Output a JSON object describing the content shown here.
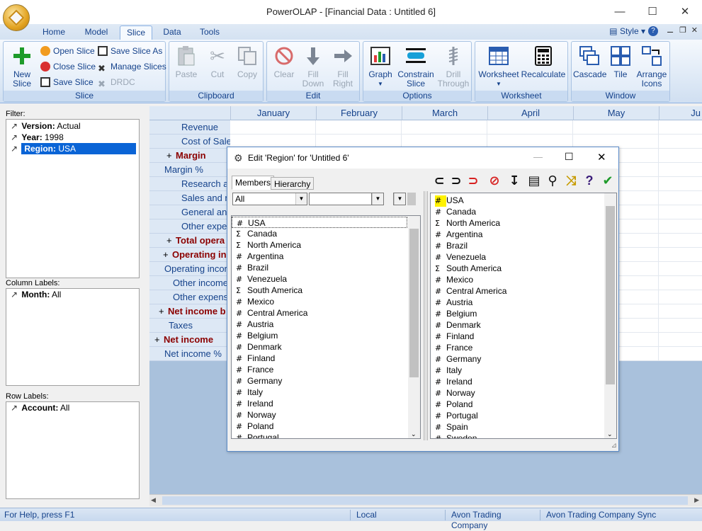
{
  "window": {
    "title": "PowerOLAP - [Financial Data : Untitled 6]"
  },
  "ribbon_tabs": [
    "Home",
    "Model",
    "Slice",
    "Data",
    "Tools"
  ],
  "style_menu": "Style",
  "ribbon": {
    "slice": {
      "label": "Slice",
      "new_slice": "New Slice",
      "open_slice": "Open Slice",
      "close_slice": "Close Slice",
      "save_slice": "Save Slice",
      "save_slice_as": "Save Slice As",
      "manage_slices": "Manage Slices",
      "drdc": "DRDC"
    },
    "clipboard": {
      "label": "Clipboard",
      "paste": "Paste",
      "cut": "Cut",
      "copy": "Copy"
    },
    "edit": {
      "label": "Edit",
      "clear": "Clear",
      "fill_down": "Fill Down",
      "fill_right": "Fill Right"
    },
    "options": {
      "label": "Options",
      "graph": "Graph",
      "constrain_slice": "Constrain Slice",
      "drill_through": "Drill Through"
    },
    "worksheet": {
      "label": "Worksheet",
      "worksheet": "Worksheet",
      "recalculate": "Recalculate"
    },
    "window": {
      "label": "Window",
      "cascade": "Cascade",
      "tile": "Tile",
      "arrange_icons": "Arrange Icons"
    }
  },
  "filter": {
    "label": "Filter:",
    "items": [
      {
        "name": "Version:",
        "value": "Actual"
      },
      {
        "name": "Year:",
        "value": "1998"
      },
      {
        "name": "Region:",
        "value": "USA"
      }
    ]
  },
  "column_labels": {
    "label": "Column Labels:",
    "items": [
      {
        "name": "Month:",
        "value": "All"
      }
    ]
  },
  "row_labels": {
    "label": "Row Labels:",
    "items": [
      {
        "name": "Account:",
        "value": "All"
      }
    ]
  },
  "grid": {
    "columns": [
      "January",
      "February",
      "March",
      "April",
      "May",
      "Ju"
    ],
    "rows": [
      "Revenue",
      "Cost of Sale",
      "Margin",
      "Margin %",
      "Research a",
      "Sales and m",
      "General an",
      "Other expe",
      "Total opera",
      "Operating in",
      "Operating incor",
      "Other income",
      "Other expens",
      "Net income b",
      "Taxes",
      "Net income",
      "Net income %"
    ]
  },
  "dialog": {
    "title": "Edit 'Region' for 'Untitled 6'",
    "tabs": [
      "Members",
      "Hierarchy"
    ],
    "filter_combo": "All",
    "left_members": [
      {
        "g": "#",
        "n": "USA"
      },
      {
        "g": "Σ",
        "n": "Canada"
      },
      {
        "g": "Σ",
        "n": "North America"
      },
      {
        "g": "#",
        "n": "Argentina"
      },
      {
        "g": "#",
        "n": "Brazil"
      },
      {
        "g": "#",
        "n": "Venezuela"
      },
      {
        "g": "Σ",
        "n": "South America"
      },
      {
        "g": "#",
        "n": "Mexico"
      },
      {
        "g": "#",
        "n": "Central America"
      },
      {
        "g": "#",
        "n": "Austria"
      },
      {
        "g": "#",
        "n": "Belgium"
      },
      {
        "g": "#",
        "n": "Denmark"
      },
      {
        "g": "#",
        "n": "Finland"
      },
      {
        "g": "#",
        "n": "France"
      },
      {
        "g": "#",
        "n": "Germany"
      },
      {
        "g": "#",
        "n": "Italy"
      },
      {
        "g": "#",
        "n": "Ireland"
      },
      {
        "g": "#",
        "n": "Norway"
      },
      {
        "g": "#",
        "n": "Poland"
      },
      {
        "g": "#",
        "n": "Portugal"
      }
    ],
    "right_members": [
      {
        "g": "#",
        "n": "USA"
      },
      {
        "g": "#",
        "n": "Canada"
      },
      {
        "g": "Σ",
        "n": "North America"
      },
      {
        "g": "#",
        "n": "Argentina"
      },
      {
        "g": "#",
        "n": "Brazil"
      },
      {
        "g": "#",
        "n": "Venezuela"
      },
      {
        "g": "Σ",
        "n": "South America"
      },
      {
        "g": "#",
        "n": "Mexico"
      },
      {
        "g": "#",
        "n": "Central America"
      },
      {
        "g": "#",
        "n": "Austria"
      },
      {
        "g": "#",
        "n": "Belgium"
      },
      {
        "g": "#",
        "n": "Denmark"
      },
      {
        "g": "#",
        "n": "Finland"
      },
      {
        "g": "#",
        "n": "France"
      },
      {
        "g": "#",
        "n": "Germany"
      },
      {
        "g": "#",
        "n": "Italy"
      },
      {
        "g": "#",
        "n": "Ireland"
      },
      {
        "g": "#",
        "n": "Norway"
      },
      {
        "g": "#",
        "n": "Poland"
      },
      {
        "g": "#",
        "n": "Portugal"
      },
      {
        "g": "#",
        "n": "Spain"
      },
      {
        "g": "#",
        "n": "Sweden"
      }
    ]
  },
  "status": {
    "help": "For Help, press F1",
    "mode": "Local",
    "server": "Avon Trading Company",
    "sync": "Avon Trading Company Sync"
  },
  "colors": {
    "accent": "#15428b",
    "bold_row": "#8b0000",
    "selection": "#0a64d6"
  }
}
